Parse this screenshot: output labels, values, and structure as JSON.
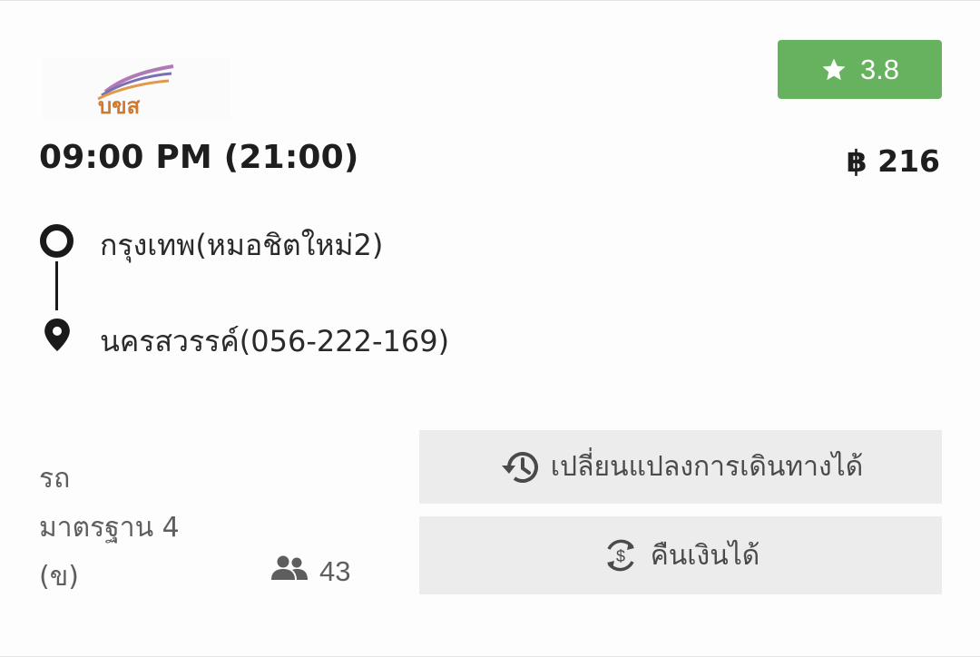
{
  "operator": {
    "logo_text": "บขส"
  },
  "rating": {
    "icon": "star-icon",
    "value": "3.8",
    "color": "#66b25e"
  },
  "departure": {
    "time": "09:00 PM (21:00)"
  },
  "fare": {
    "price": "฿ 216"
  },
  "route": {
    "origin": "กรุงเทพ(หมอชิตใหม่2)",
    "destination": "นครสวรรค์(056-222-169)"
  },
  "bus": {
    "type_line1": "รถ",
    "type_line2": "มาตรฐาน 4",
    "type_line3": "(ข)"
  },
  "seats": {
    "icon": "people-icon",
    "available": "43"
  },
  "policies": {
    "changeable": {
      "icon": "history-icon",
      "label": "เปลี่ยนแปลงการเดินทางได้"
    },
    "refundable": {
      "icon": "refund-icon",
      "label": "คืนเงินได้"
    }
  }
}
